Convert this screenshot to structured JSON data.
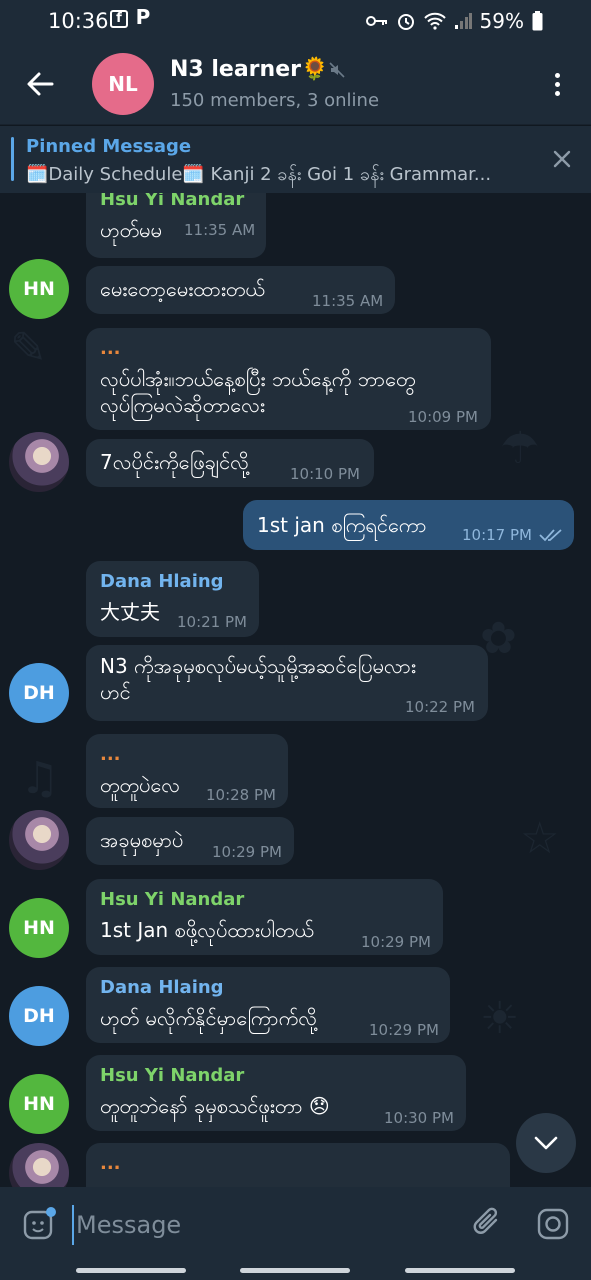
{
  "status_bar": {
    "time": "10:36",
    "left_icons": [
      "f",
      "P"
    ],
    "battery": "59%"
  },
  "header": {
    "avatar_initials": "NL",
    "title": "N3 learner🌻",
    "subtitle": "150 members, 3 online"
  },
  "pinned": {
    "title": "Pinned Message",
    "text": "🗓️Daily Schedule🗓️  Kanji 2 ခန်း  Goi 1 ခန်း   Grammar..."
  },
  "messages": [
    {
      "sender": "Hsu Yi Nandar",
      "text": "ဟုတ်မမ",
      "time": "11:35 AM"
    },
    {
      "avatar": "HN",
      "text": "မေးတော့မေးထားတယ်",
      "time": "11:35 AM"
    },
    {
      "sender": "...",
      "lines": [
        "လုပ်ပါအုံး။ဘယ်နေ့စပြီး ဘယ်နေ့ကို ဘာတွေ",
        "လုပ်ကြမလဲဆိုတာလေး"
      ],
      "time": "10:09 PM"
    },
    {
      "text": "7လပိုင်းကိုဖြေချင်လို့",
      "time": "10:10 PM"
    },
    {
      "outgoing": true,
      "text": "1st jan  စကြရင်ကော",
      "time": "10:17 PM"
    },
    {
      "sender": "Dana Hlaing",
      "text": "大丈夫",
      "time": "10:21 PM"
    },
    {
      "avatar": "DH",
      "lines": [
        "N3 ကိုအခုမှစလုပ်မယ့်သူမို့အဆင်ပြေမလား",
        "ဟင်"
      ],
      "time": "10:22 PM"
    },
    {
      "sender": "...",
      "text": "တူတူပဲလေ",
      "time": "10:28 PM"
    },
    {
      "text": "အခုမှစမှာပဲ",
      "time": "10:29 PM"
    },
    {
      "sender": "Hsu Yi Nandar",
      "avatar": "HN",
      "text": "1st Jan စဖို့လုပ်ထားပါတယ်",
      "time": "10:29 PM"
    },
    {
      "sender": "Dana Hlaing",
      "avatar": "DH",
      "text": "ဟုတ် မလိုက်နိုင်မှာကြောက်လို့",
      "time": "10:29 PM"
    },
    {
      "sender": "Hsu Yi Nandar",
      "avatar": "HN",
      "text": "တူတူဘဲနော် ခုမှစသင်ဖူးတာ 😞",
      "time": "10:30 PM"
    },
    {
      "sender": "..."
    }
  ],
  "input": {
    "placeholder": "Message"
  },
  "colors": {
    "accent": "#5ba7e8",
    "green_sender": "#7ed36a",
    "blue_sender": "#72b4ee",
    "outgoing": "#2b5278"
  }
}
